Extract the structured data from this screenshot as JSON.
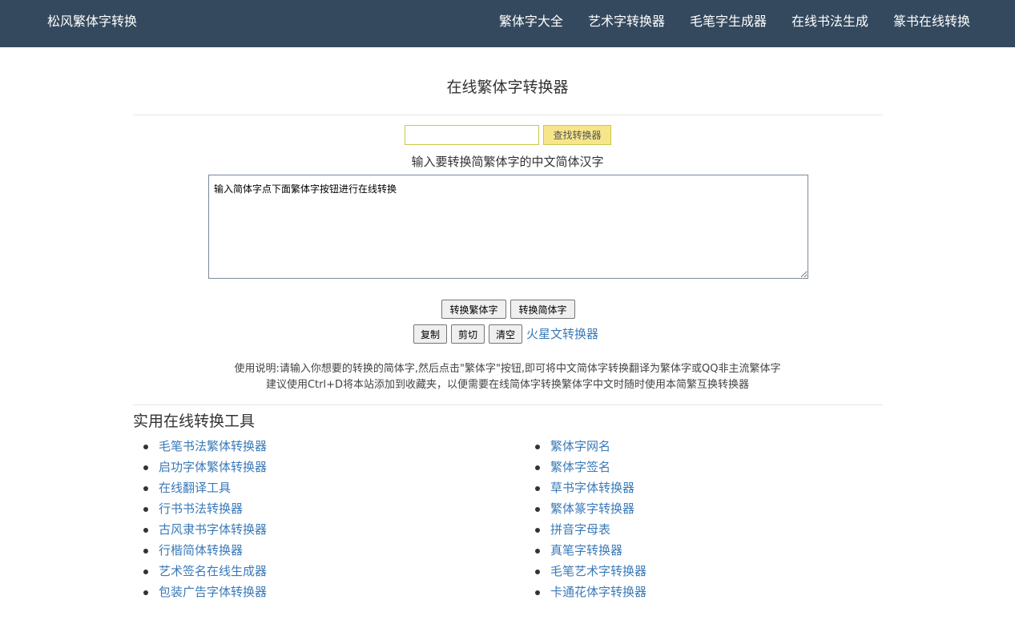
{
  "navbar": {
    "brand": "松风繁体字转换",
    "links": [
      "繁体字大全",
      "艺术字转换器",
      "毛笔字生成器",
      "在线书法生成",
      "篆书在线转换"
    ]
  },
  "main": {
    "title": "在线繁体字转换器",
    "search": {
      "value": "",
      "button_label": "查找转换器"
    },
    "input_label": "输入要转换简繁体字的中文简体汉字",
    "textarea_value": "输入简体字点下面繁体字按钮进行在线转换",
    "buttons": {
      "to_traditional": "转换繁体字",
      "to_simplified": "转换简体字",
      "copy": "复制",
      "cut": "剪切",
      "clear": "清空"
    },
    "mars_link": "火星文转换器",
    "instructions": [
      "使用说明:请输入你想要的转换的简体字,然后点击\"繁体字\"按钮,即可将中文简体字转换翻译为繁体字或QQ非主流繁体字",
      "建议使用Ctrl+D将本站添加到收藏夹，以便需要在线简体字转换繁体字中文时随时使用本简繁互换转换器"
    ]
  },
  "tools": {
    "heading": "实用在线转换工具",
    "left": [
      "毛笔书法繁体转换器",
      "启功字体繁体转换器",
      "在线翻译工具",
      "行书书法转换器",
      "古风隶书字体转换器",
      "行楷简体转换器",
      "艺术签名在线生成器",
      "包装广告字体转换器"
    ],
    "right": [
      "繁体字网名",
      "繁体字签名",
      "草书字体转换器",
      "繁体篆字转换器",
      "拼音字母表",
      "真笔字转换器",
      "毛笔艺术字转换器",
      "卡通花体字转换器"
    ]
  },
  "colors": {
    "navbar_bg": "#34495e",
    "link": "#3a7ab8",
    "search_button_bg": "#f7e58a"
  }
}
